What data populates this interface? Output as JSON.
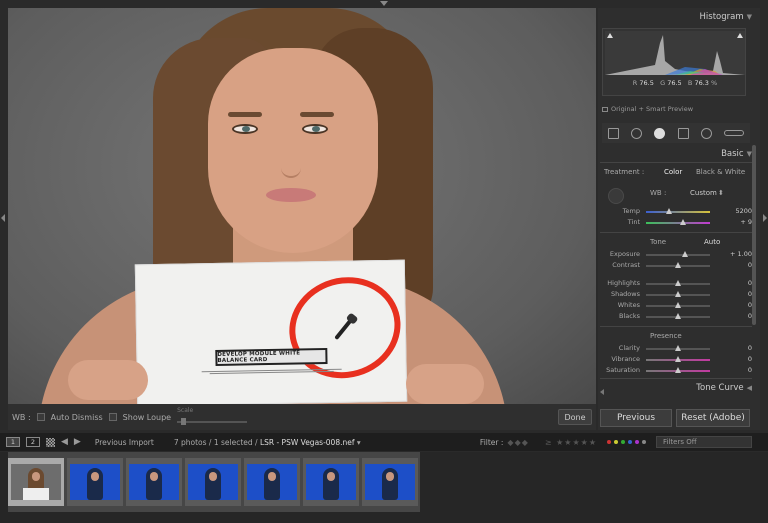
{
  "toolbar": {
    "wb_label": "WB :",
    "auto_dismiss": "Auto Dismiss",
    "show_loupe": "Show Loupe",
    "scale_label": "Scale",
    "done": "Done"
  },
  "photo": {
    "card_title": "DEVELOP MODULE WHITE BALANCE CARD"
  },
  "histogram": {
    "title": "Histogram",
    "r_label": "R",
    "r_value": "76.5",
    "g_label": "G",
    "g_value": "76.5",
    "b_label": "B",
    "b_value": "76.3",
    "pct": "%",
    "preview": "Original + Smart Preview"
  },
  "basic": {
    "title": "Basic",
    "treatment_label": "Treatment :",
    "treatment_color": "Color",
    "treatment_bw": "Black & White",
    "wb_label": "WB :",
    "wb_value": "Custom",
    "temp_label": "Temp",
    "temp_value": "5200",
    "tint_label": "Tint",
    "tint_value": "+ 9",
    "tone_label": "Tone",
    "auto_label": "Auto",
    "exposure_label": "Exposure",
    "exposure_value": "+ 1.00",
    "contrast_label": "Contrast",
    "contrast_value": "0",
    "highlights_label": "Highlights",
    "highlights_value": "0",
    "shadows_label": "Shadows",
    "shadows_value": "0",
    "whites_label": "Whites",
    "whites_value": "0",
    "blacks_label": "Blacks",
    "blacks_value": "0",
    "presence_label": "Presence",
    "clarity_label": "Clarity",
    "clarity_value": "0",
    "vibrance_label": "Vibrance",
    "vibrance_value": "0",
    "saturation_label": "Saturation",
    "saturation_value": "0"
  },
  "tone_curve": {
    "title": "Tone Curve"
  },
  "buttons": {
    "previous": "Previous",
    "reset": "Reset (Adobe)"
  },
  "filmbar": {
    "monitor1": "1",
    "monitor2": "2",
    "source": "Previous Import",
    "count": "7 photos / 1 selected /",
    "file": "LSR - PSW Vegas-008.nef",
    "filter_label": "Filter :",
    "filters_off": "Filters Off"
  },
  "colors": {
    "thumb_blue": "#1d4fc8",
    "accent_red": "#e8301f"
  }
}
